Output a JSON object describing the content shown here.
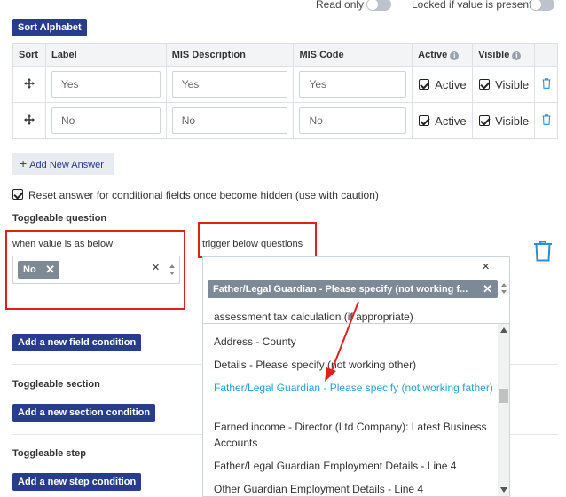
{
  "toggles": {
    "read_only": "Read only",
    "locked": "Locked if value is present"
  },
  "sort_button": "Sort Alphabet",
  "table": {
    "headers": {
      "sort": "Sort",
      "label": "Label",
      "mis_description": "MIS Description",
      "mis_code": "MIS Code",
      "active": "Active",
      "visible": "Visible"
    },
    "rows": [
      {
        "label": "Yes",
        "mis_description": "Yes",
        "mis_code": "Yes",
        "active": "Active",
        "visible": "Visible"
      },
      {
        "label": "No",
        "mis_description": "No",
        "mis_code": "No",
        "active": "Active",
        "visible": "Visible"
      }
    ]
  },
  "add_answer": "Add New Answer",
  "reset_checkbox": "Reset answer for conditional fields once become hidden (use with caution)",
  "toggleable_question": "Toggleable question",
  "when_value": "when value is as below",
  "when_tag": "No",
  "trigger_label": "trigger below questions",
  "trigger_tag": "Father/Legal Guardian - Please specify (not working f...",
  "dropdown_items": [
    "assessment tax calculation (if appropriate)",
    "Address - County",
    "Details - Please specify (not working other)",
    "Father/Legal Guardian - Please specify (not working father)",
    "Earned income - Director (Ltd Company): Latest Business Accounts",
    "Father/Legal Guardian Employment Details - Line 4",
    "Other Guardian Employment Details - Line 4"
  ],
  "add_field_condition": "Add a new field condition",
  "toggleable_section": "Toggleable section",
  "add_section_condition": "Add a new section condition",
  "toggleable_step": "Toggleable step",
  "add_step_condition": "Add a new step condition",
  "colors": {
    "primary_button": "#283c8c",
    "highlight_red": "#e02020",
    "link_blue": "#2a9fe0",
    "tag_gray": "#7d8a96"
  }
}
